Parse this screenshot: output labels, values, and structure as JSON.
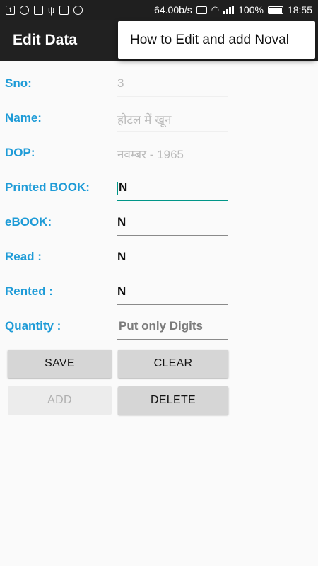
{
  "status_bar": {
    "left_icons": [
      "facebook-icon",
      "whatsapp-icon",
      "message-icon",
      "usb-icon",
      "image-icon",
      "emoji-icon"
    ],
    "speed": "64.00b/s",
    "battery": "100%",
    "time": "18:55"
  },
  "app_bar": {
    "title": "Edit Data",
    "menu_popup_item": "How to Edit and add Noval"
  },
  "form": {
    "sno": {
      "label": "Sno:",
      "value": "3"
    },
    "name": {
      "label": "Name:",
      "value": "होटल में खून"
    },
    "dop": {
      "label": "DOP:",
      "value": "नवम्बर - 1965"
    },
    "printed_book": {
      "label": "Printed BOOK:",
      "value": "N"
    },
    "ebook": {
      "label": "eBOOK:",
      "value": "N"
    },
    "read": {
      "label": "Read :",
      "value": "N"
    },
    "rented": {
      "label": "Rented :",
      "value": "N"
    },
    "quantity": {
      "label": "Quantity :",
      "placeholder": "Put only Digits"
    }
  },
  "buttons": {
    "save": "SAVE",
    "clear": "CLEAR",
    "add": "ADD",
    "delete": "DELETE"
  },
  "colors": {
    "label": "#1e9bd7",
    "accent": "#009688",
    "app_bar": "#212121"
  }
}
